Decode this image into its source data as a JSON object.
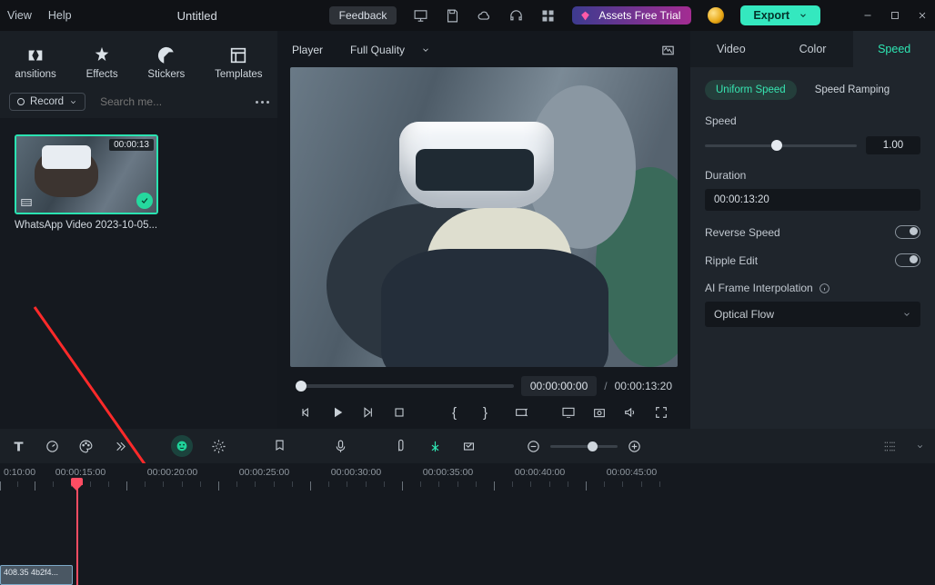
{
  "menu": {
    "view": "View",
    "help": "Help"
  },
  "title": "Untitled",
  "topbar": {
    "feedback": "Feedback",
    "assets": "Assets Free Trial",
    "export": "Export"
  },
  "left_tabs": {
    "transitions": "ansitions",
    "effects": "Effects",
    "stickers": "Stickers",
    "templates": "Templates"
  },
  "searchbar": {
    "record": "Record",
    "placeholder": "Search me..."
  },
  "clip": {
    "duration": "00:00:13",
    "name": "WhatsApp Video 2023-10-05..."
  },
  "player": {
    "label": "Player",
    "quality": "Full Quality",
    "current": "00:00:00:00",
    "sep": "/",
    "total": "00:00:13:20"
  },
  "right": {
    "tabs": {
      "video": "Video",
      "color": "Color",
      "speed": "Speed"
    },
    "subtabs": {
      "uniform": "Uniform Speed",
      "ramping": "Speed Ramping"
    },
    "speed_label": "Speed",
    "speed_value": "1.00",
    "duration_label": "Duration",
    "duration_value": "00:00:13:20",
    "reverse": "Reverse Speed",
    "ripple": "Ripple Edit",
    "aiframe": "AI Frame Interpolation",
    "aiframe_value": "Optical Flow"
  },
  "ruler": [
    "0:10:00",
    "00:00:15:00",
    "00:00:20:00",
    "00:00:25:00",
    "00:00:30:00",
    "00:00:35:00",
    "00:00:40:00",
    "00:00:45:00"
  ],
  "timeline_clip": "408.35 4b2f4..."
}
